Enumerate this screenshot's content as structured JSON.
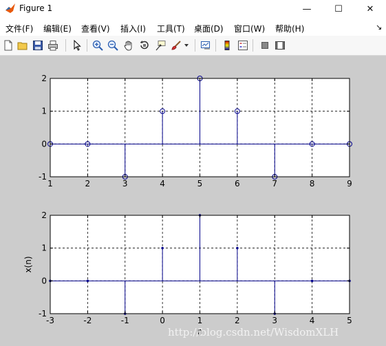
{
  "window": {
    "title": "Figure 1",
    "controls": {
      "minimize": "—",
      "maximize": "☐",
      "close": "✕"
    }
  },
  "menu": {
    "items": [
      "文件(F)",
      "编辑(E)",
      "查看(V)",
      "插入(I)",
      "工具(T)",
      "桌面(D)",
      "窗口(W)",
      "帮助(H)"
    ],
    "overflow_arrow": "↘"
  },
  "toolbar": {
    "icons": [
      "new-figure-icon",
      "open-file-icon",
      "save-icon",
      "print-icon",
      "select-arrow-icon",
      "zoom-in-icon",
      "zoom-out-icon",
      "pan-hand-icon",
      "rotate-3d-icon",
      "data-cursor-icon",
      "brush-icon",
      "brush-dropdown-icon",
      "link-plot-icon",
      "colorbar-icon",
      "legend-icon",
      "hide-plot-tools-icon",
      "show-plot-tools-icon"
    ]
  },
  "watermark": "http://blog.csdn.net/WisdomXLH",
  "colors": {
    "stem": "#00008b",
    "figure_bg": "#cccccc",
    "axes_bg": "#ffffff"
  },
  "chart_data": [
    {
      "type": "stem",
      "marker": "circle-open",
      "x": [
        1,
        2,
        3,
        4,
        5,
        6,
        7,
        8,
        9
      ],
      "y": [
        0,
        0,
        -1,
        1,
        2,
        1,
        -1,
        0,
        0
      ],
      "xlim": [
        1,
        9
      ],
      "ylim": [
        -1,
        2
      ],
      "xticks": [
        "1",
        "2",
        "3",
        "4",
        "5",
        "6",
        "7",
        "8",
        "9"
      ],
      "yticks": [
        "-1",
        "0",
        "1",
        "2"
      ],
      "xlabel": "",
      "ylabel": "",
      "grid": true
    },
    {
      "type": "stem",
      "marker": "dot",
      "x": [
        -3,
        -2,
        -1,
        0,
        1,
        2,
        3,
        4,
        5
      ],
      "y": [
        0,
        0,
        -1,
        1,
        2,
        1,
        -1,
        0,
        0
      ],
      "xlim": [
        -3,
        5
      ],
      "ylim": [
        -1,
        2
      ],
      "xticks": [
        "-3",
        "-2",
        "-1",
        "0",
        "1",
        "2",
        "3",
        "4",
        "5"
      ],
      "yticks": [
        "-1",
        "0",
        "1",
        "2"
      ],
      "xlabel": "n",
      "ylabel": "x(n)",
      "grid": true
    }
  ]
}
